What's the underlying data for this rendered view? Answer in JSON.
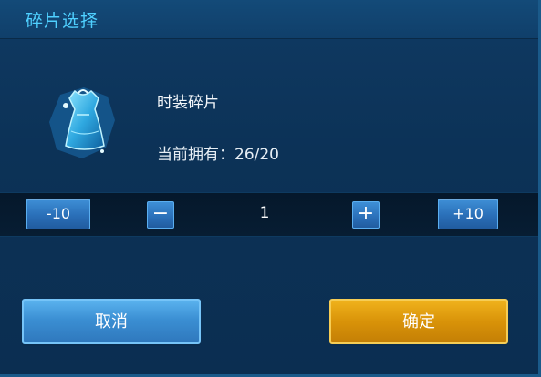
{
  "dialog": {
    "title": "碎片选择"
  },
  "item": {
    "icon": "costume-fragment-icon",
    "name": "时装碎片",
    "owned_label": "当前拥有：26/20"
  },
  "stepper": {
    "minus10_label": "-10",
    "minus_label": "−",
    "quantity": "1",
    "plus_label": "+",
    "plus10_label": "+10"
  },
  "actions": {
    "cancel_label": "取消",
    "confirm_label": "确定"
  },
  "colors": {
    "title": "#4fd0ff",
    "panel": "#0c3257",
    "blue_button": "#2a6fb8",
    "gold_button": "#d99309"
  }
}
